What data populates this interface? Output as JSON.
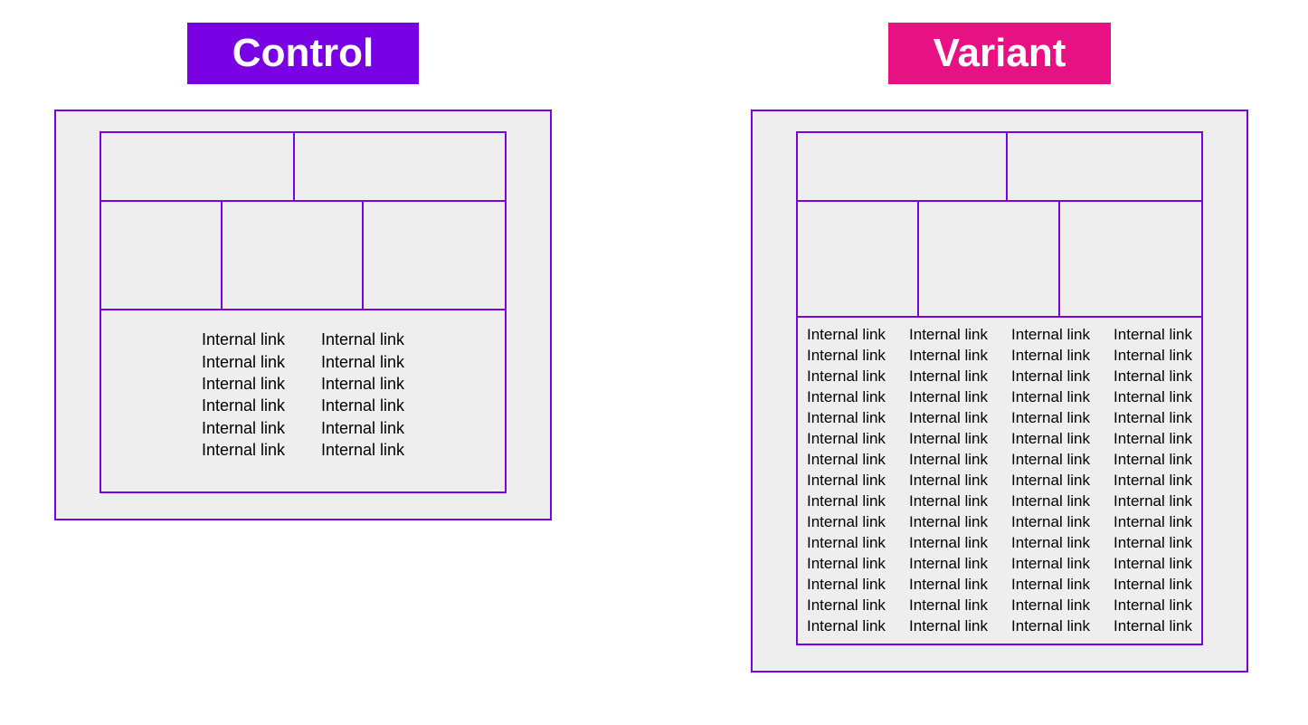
{
  "colors": {
    "border": "#7800e2",
    "control_badge": "#7800e2",
    "variant_badge": "#e61284",
    "panel_bg": "#eeeeee",
    "badge_text": "#ffffff",
    "link_text": "#000000"
  },
  "control": {
    "title": "Control",
    "link_label": "Internal link",
    "columns": 2,
    "links_per_column": 6
  },
  "variant": {
    "title": "Variant",
    "link_label": "Internal link",
    "columns": 4,
    "links_per_column": 15
  }
}
